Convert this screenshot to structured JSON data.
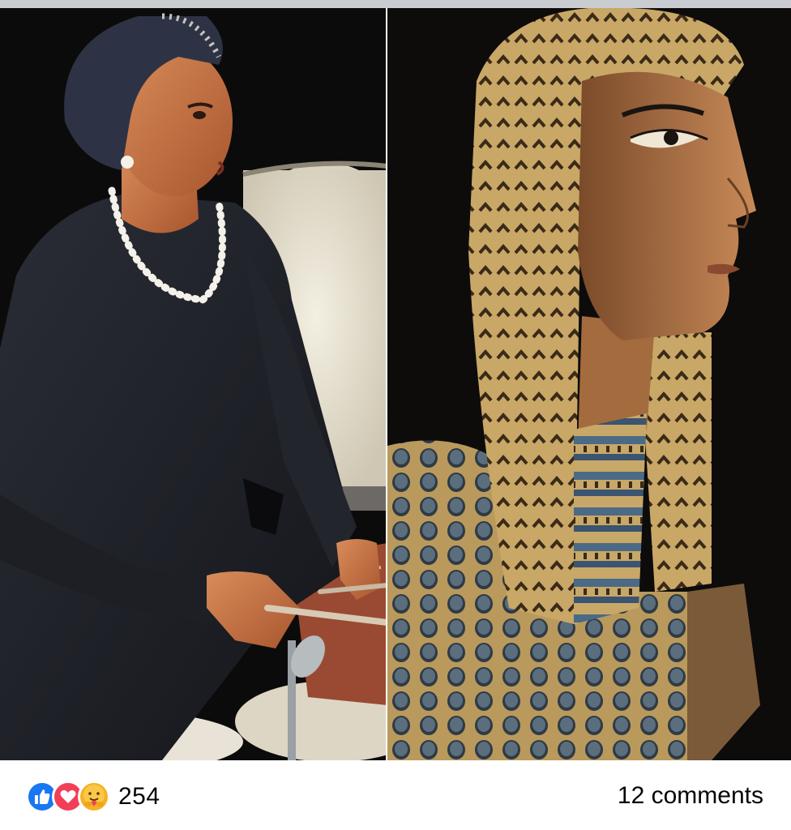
{
  "post": {
    "images": [
      {
        "name": "drummer-photo"
      },
      {
        "name": "sarcophagus-photo"
      }
    ],
    "reactions": {
      "icons": [
        "like-icon",
        "love-icon",
        "care-icon"
      ],
      "count": "254"
    },
    "comments_label": "12 comments"
  },
  "colors": {
    "like": "#1877f2",
    "love": "#f33e58",
    "care": "#f7b125",
    "background": "#ffffff",
    "text": "#050505"
  }
}
